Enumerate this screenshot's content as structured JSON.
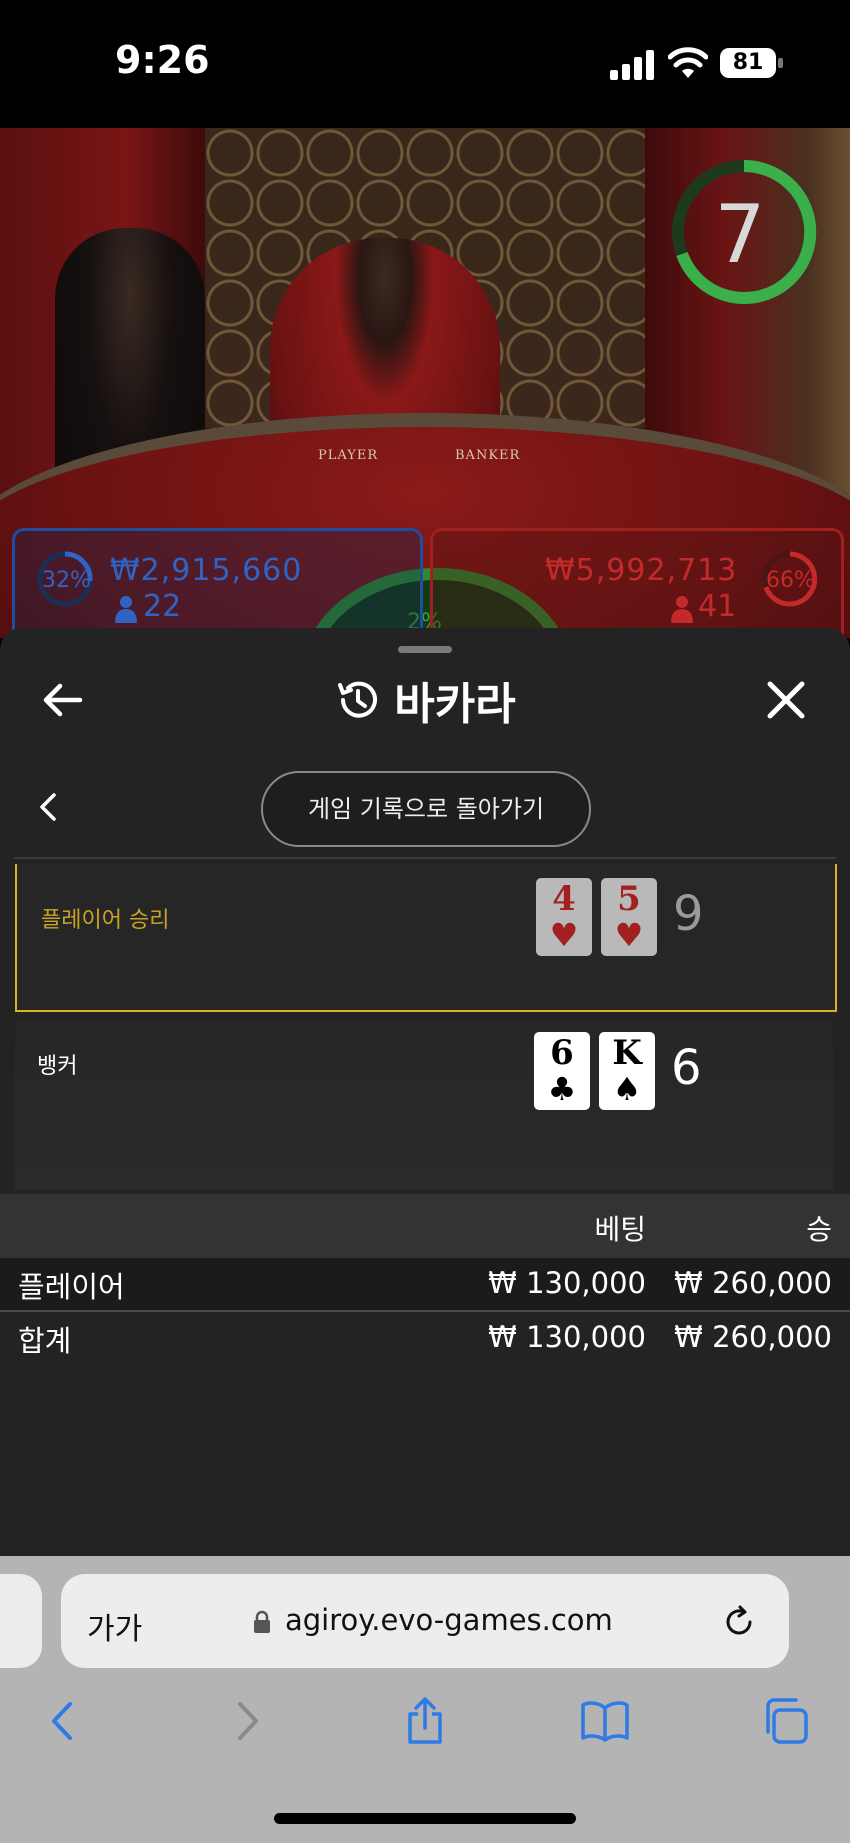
{
  "status_bar": {
    "time": "9:26",
    "battery": "81"
  },
  "video": {
    "timer": "7",
    "table_labels": {
      "player": "PLAYER",
      "banker": "BANKER"
    },
    "player_bet": {
      "percent": "32%",
      "amount": "₩2,915,660",
      "players": "22",
      "color": "#2f63c4"
    },
    "banker_bet": {
      "percent": "66%",
      "amount": "₩5,992,713",
      "players": "41",
      "color": "#c42a2a"
    },
    "tie_bet": {
      "percent": "2%",
      "color": "#3aa13a"
    }
  },
  "sheet": {
    "title": "바카라",
    "return_button": "게임 기록으로 돌아가기",
    "player_result": {
      "label": "플레이어 승리",
      "label_color": "#c9a227",
      "cards": [
        {
          "rank": "4",
          "suit": "♥"
        },
        {
          "rank": "5",
          "suit": "♥"
        }
      ],
      "score": "9"
    },
    "banker_result": {
      "label": "뱅커",
      "cards": [
        {
          "rank": "6",
          "suit": "♣"
        },
        {
          "rank": "K",
          "suit": "♠"
        }
      ],
      "score": "6"
    },
    "bets": {
      "headers": {
        "bet": "베팅",
        "win": "승"
      },
      "rows": [
        {
          "name": "플레이어",
          "bet": "₩ 130,000",
          "win": "₩ 260,000"
        },
        {
          "name": "합계",
          "bet": "₩ 130,000",
          "win": "₩ 260,000"
        }
      ]
    }
  },
  "browser": {
    "text_size": "가가",
    "url": "agiroy.evo-games.com",
    "accent": "#2f7ae5"
  }
}
